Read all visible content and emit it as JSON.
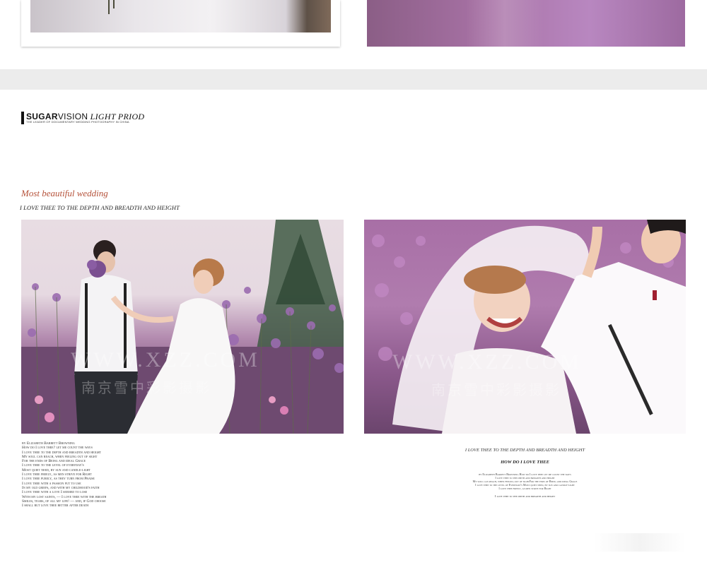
{
  "brand": {
    "name_bold": "SUGAR",
    "name_regular": "VISION",
    "name_italic": " LIGHT PRIOD",
    "tagline": "THE LEADER OF DOCUMENTARY WEDDING PHOTOGRAPHY IN CHINA"
  },
  "heading": {
    "script": "Most beautiful wedding",
    "fine_print": "",
    "main": "I LOVE THEE TO THE DEPTH AND BREADTH AND HEIGHT"
  },
  "photos": {
    "watermark_latin": "WWW.XZZ.COM",
    "watermark_cn": "南京雪中彩影摄影"
  },
  "poem_left": [
    "by Elizabeth Barrett Browning",
    "How do I love thee? let me count the ways",
    "I love thee to the depth and breadth and height",
    "My soul can reach, when feeling out of sight",
    "For the ends of Being and ideal Grace",
    "I love thee to the level of everyday's",
    "Most quiet need, by sun and candle-light",
    "I love thee freely, as men strive for Right",
    "I love thee purely, as they turn from Praise",
    "I love thee with a passion put to use",
    "In my old griefs, and with my childhood's faith",
    "I love thee with a love I seemed to lose",
    "With my lost saints, — I love thee with the breath",
    "Smiles, tears, of all my life! — and, if God choose",
    "I shall but love thee better after death"
  ],
  "right_caption": {
    "title": "I LOVE THEE TO THE DEPTH AND BREADTH AND HEIGHT",
    "subtitle": "HOW DO I LOVE THEE",
    "lines": [
      "by Elizabeth Barrett Browning How do I love thee let me count the ways",
      "I love thee to the depth and breadth and height",
      "My soul can reach, when feeling out of sightFor the ends of Being and ideal Grace",
      "I love thee to the level of Everyday's Most quiet need, by sun and candle-light",
      "I love thee freely, as men strive for Right"
    ],
    "footer": "I love thee to the depth and breadth and height"
  }
}
